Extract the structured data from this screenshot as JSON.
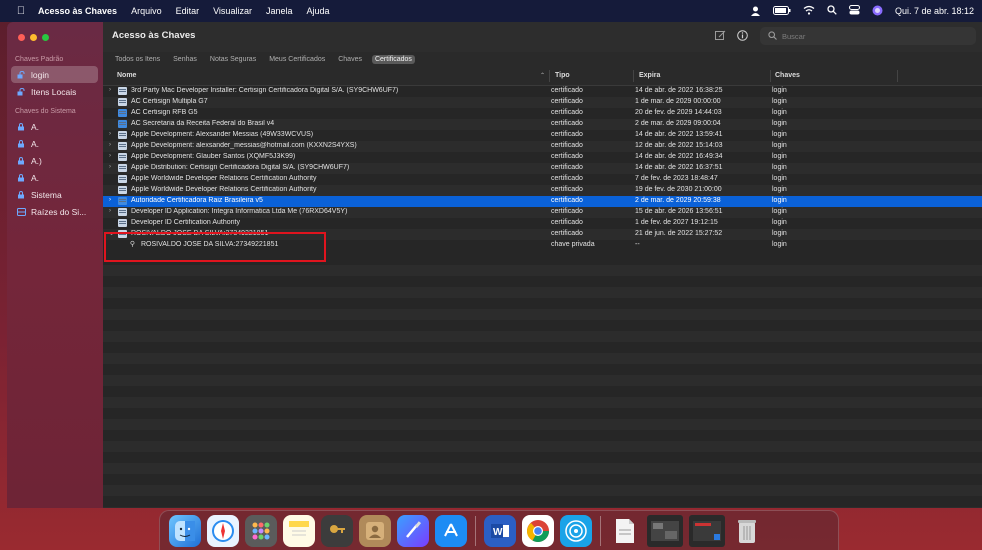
{
  "menubar": {
    "app_name": "Acesso às Chaves",
    "menus": [
      "Arquivo",
      "Editar",
      "Visualizar",
      "Janela",
      "Ajuda"
    ],
    "clock": "Qui. 7 de abr.  18:12"
  },
  "sidebar": {
    "section_default": "Chaves Padrão",
    "default_items": [
      {
        "label": "login"
      },
      {
        "label": "Itens Locais"
      }
    ],
    "section_system": "Chaves do Sistema",
    "system_items": [
      {
        "label": "A."
      },
      {
        "label": "A."
      },
      {
        "label": "A.)"
      },
      {
        "label": "A."
      },
      {
        "label": "Sistema"
      },
      {
        "label": "Raízes do Si..."
      }
    ]
  },
  "toolbar": {
    "title": "Acesso às Chaves",
    "search_placeholder": "Buscar"
  },
  "tabs": [
    "Todos os Itens",
    "Senhas",
    "Notas Seguras",
    "Meus Certificados",
    "Chaves",
    "Certificados"
  ],
  "active_tab": "Certificados",
  "table": {
    "columns": [
      "Nome",
      "Tipo",
      "Expira",
      "Chaves"
    ],
    "rows": [
      {
        "name": "3rd Party Mac Developer Installer: Certisign  Certificadora Digital S/A. (SY9CHW6UF7)",
        "type": "certificado",
        "expires": "14 de abr. de 2022 16:38:25",
        "keychain": "login"
      },
      {
        "name": "AC Certisign Multipla G7",
        "type": "certificado",
        "expires": "1 de mar. de 2029 00:00:00",
        "keychain": "login"
      },
      {
        "name": "AC Certisign RFB G5",
        "type": "certificado",
        "expires": "20 de fev. de 2029 14:44:03",
        "keychain": "login"
      },
      {
        "name": "AC Secretaria da Receita Federal do Brasil v4",
        "type": "certificado",
        "expires": "2 de mar. de 2029 09:00:04",
        "keychain": "login"
      },
      {
        "name": "Apple Development: Alexsander Messias (49W33WCVUS)",
        "type": "certificado",
        "expires": "14 de abr. de 2022 13:59:41",
        "keychain": "login"
      },
      {
        "name": "Apple Development: alexsander_messias@hotmail.com (KXXN2S4YXS)",
        "type": "certificado",
        "expires": "12 de abr. de 2022 15:14:03",
        "keychain": "login"
      },
      {
        "name": "Apple Development: Glauber Santos (XQMF5J3K99)",
        "type": "certificado",
        "expires": "14 de abr. de 2022 16:49:34",
        "keychain": "login"
      },
      {
        "name": "Apple Distribution: Certisign  Certificadora Digital S/A. (SY9CHW6UF7)",
        "type": "certificado",
        "expires": "14 de abr. de 2022 16:37:51",
        "keychain": "login"
      },
      {
        "name": "Apple Worldwide Developer Relations Certification Authority",
        "type": "certificado",
        "expires": "7 de fev. de 2023 18:48:47",
        "keychain": "login"
      },
      {
        "name": "Apple Worldwide Developer Relations Certification Authority",
        "type": "certificado",
        "expires": "19 de fev. de 2030 21:00:00",
        "keychain": "login"
      },
      {
        "name": "Autoridade Certificadora Raiz Brasileira v5",
        "type": "certificado",
        "expires": "2 de mar. de 2029 20:59:38",
        "keychain": "login"
      },
      {
        "name": "Developer ID Application: Integra Informatica Ltda Me (76RXD64V5Y)",
        "type": "certificado",
        "expires": "15 de abr. de 2026 13:56:51",
        "keychain": "login"
      },
      {
        "name": "Developer ID Certification Authority",
        "type": "certificado",
        "expires": "1 de fev. de 2027 19:12:15",
        "keychain": "login"
      },
      {
        "name": "ROSIVALDO JOSE DA SILVA:27349221851",
        "type": "certificado",
        "expires": "21 de jun. de 2022 15:27:52",
        "keychain": "login"
      },
      {
        "name": "ROSIVALDO JOSE DA SILVA:27349221851",
        "type": "chave privada",
        "expires": "--",
        "keychain": "login"
      }
    ]
  }
}
